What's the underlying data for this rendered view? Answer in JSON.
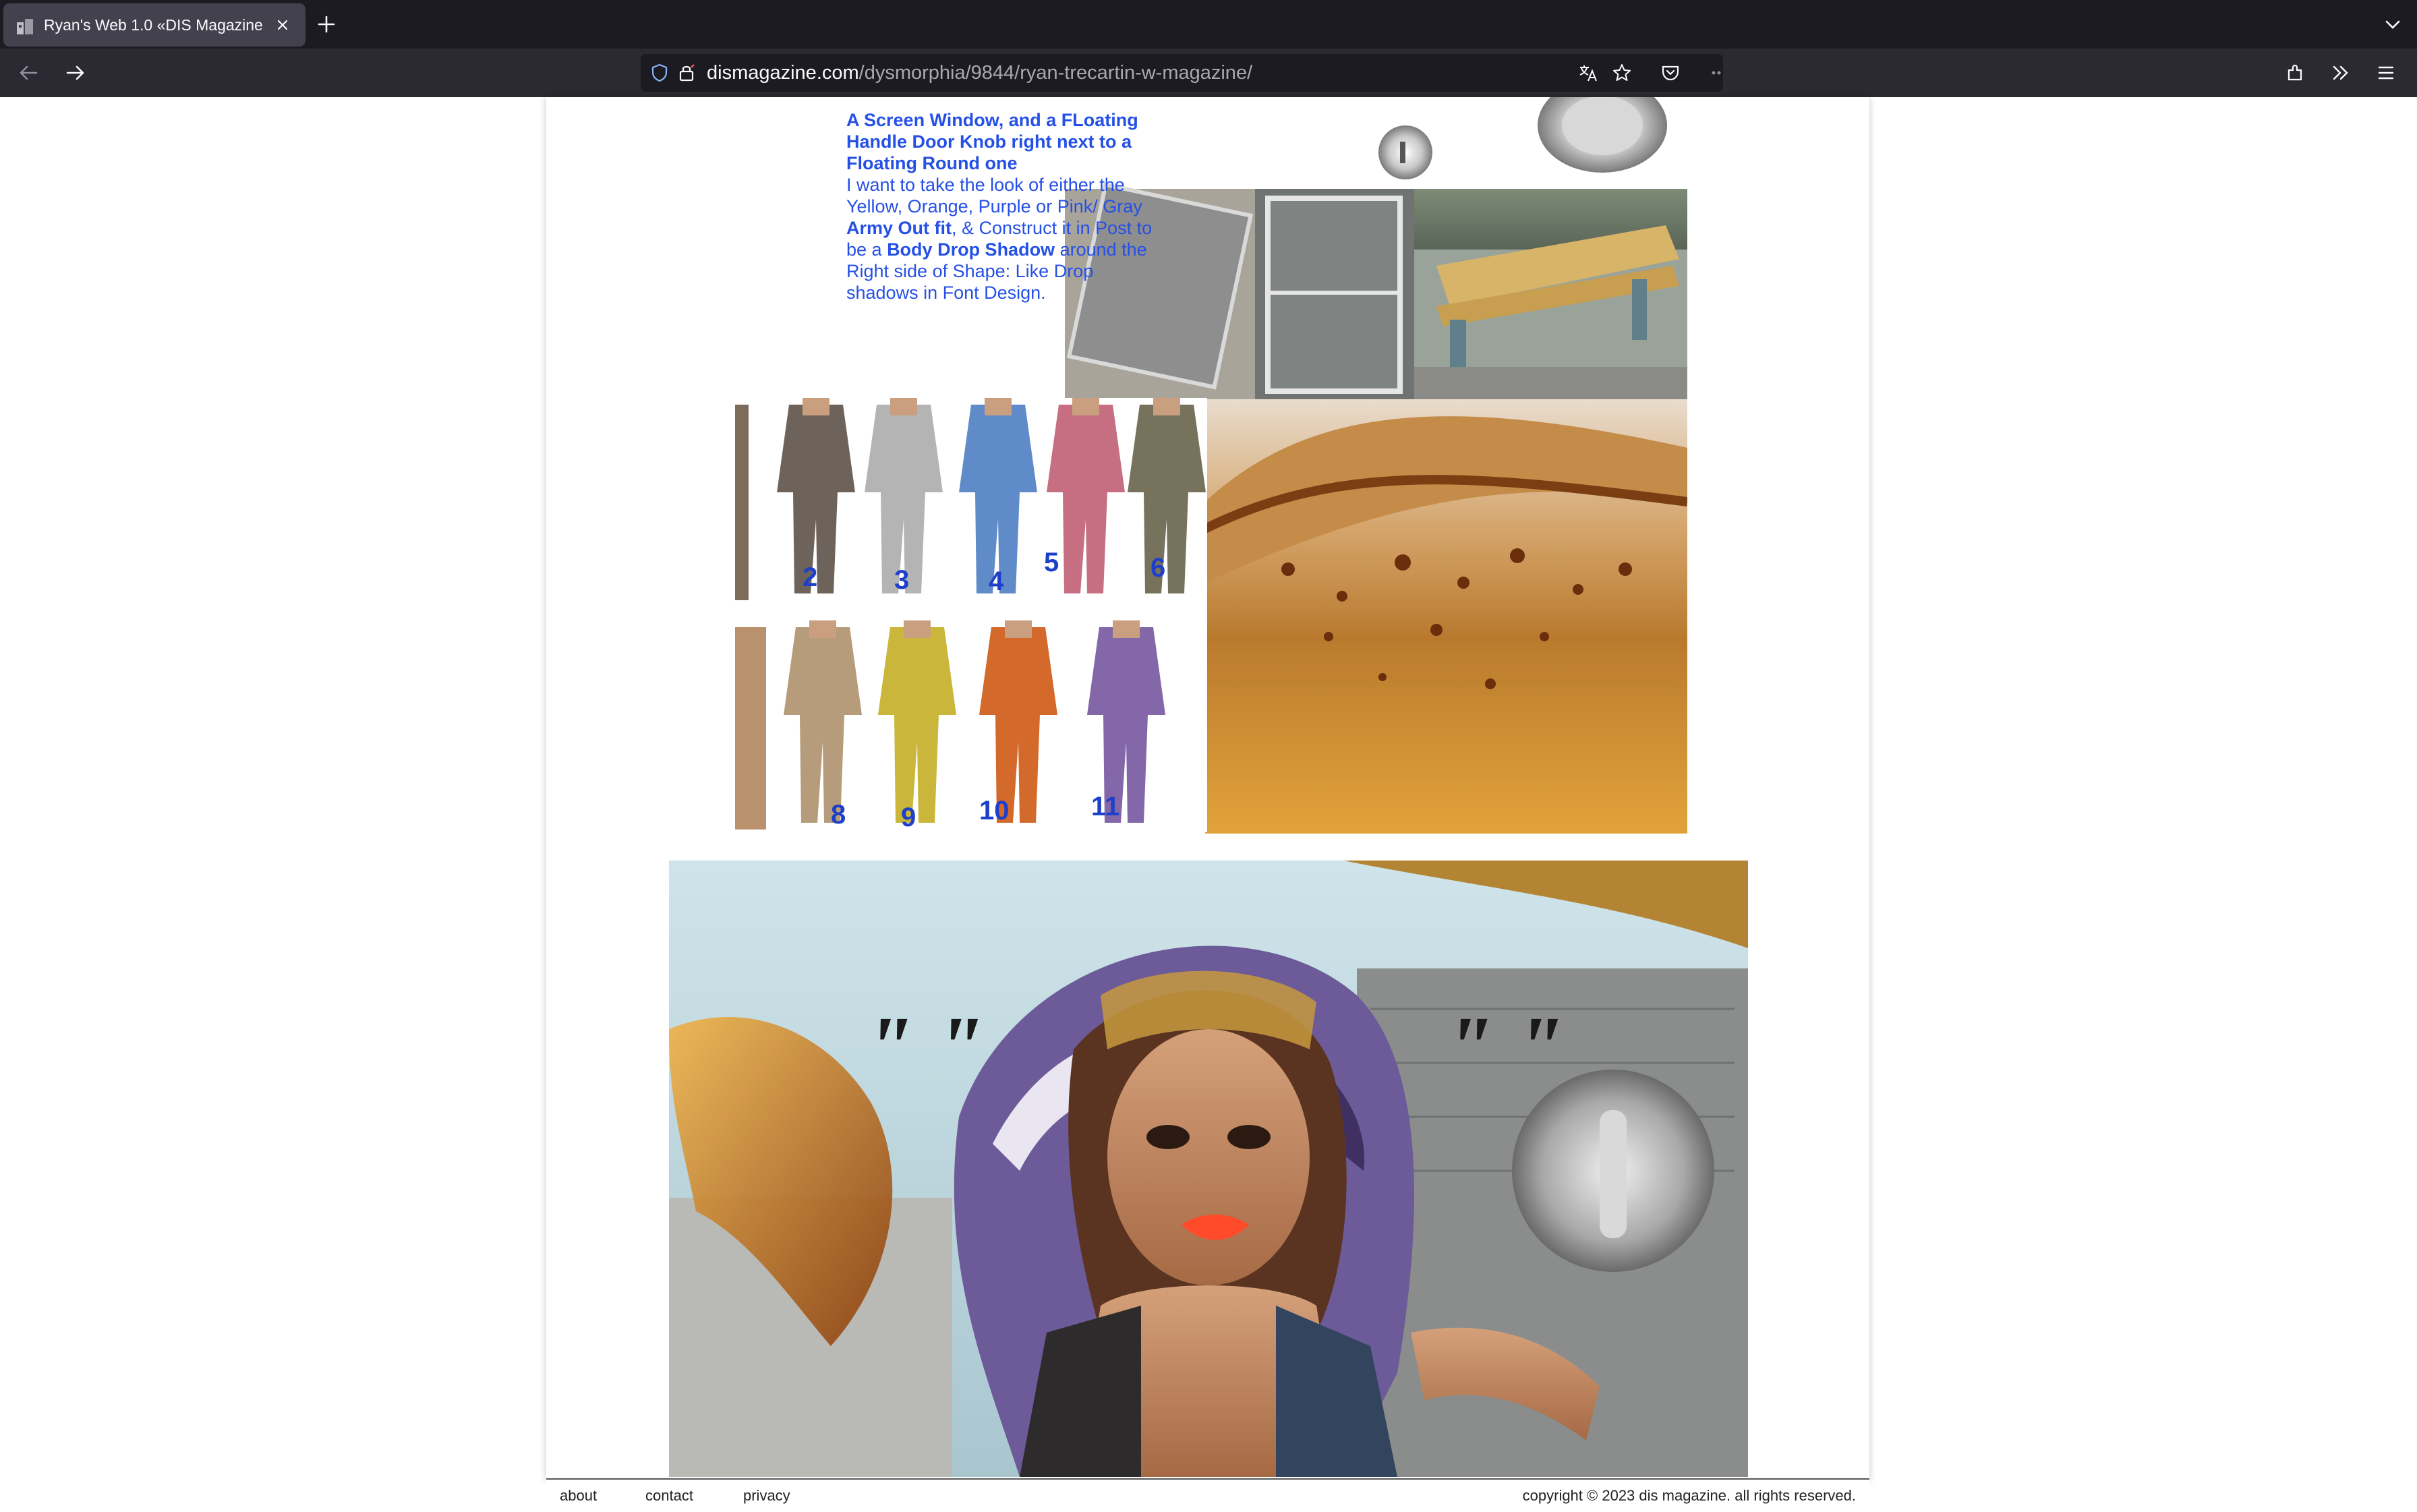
{
  "browser": {
    "tab_title": "Ryan's Web 1.0 «DIS Magazine",
    "url_domain": "dismagazine.com",
    "url_path": "/dysmorphia/9844/ryan-trecartin-w-magazine/",
    "icons": [
      "back-arrow-icon",
      "forward-arrow-icon",
      "shield-icon",
      "lock-icon",
      "translate-icon",
      "star-icon",
      "pocket-icon",
      "extensions-icon",
      "overflow-icon",
      "menu-icon",
      "close-icon",
      "plus-icon",
      "chevron-down-icon"
    ]
  },
  "collage": {
    "caption_heading": "A Screen Window, and a FLoating Handle Door Knob right next to a Floating Round one",
    "caption_body": [
      {
        "text": "I want to take the look of either the Yellow, Orange, Purple or Pink/ Gray ",
        "bold": false
      },
      {
        "text": "Army Out fit",
        "bold": true
      },
      {
        "text": ", & Construct it in Post to be a ",
        "bold": false
      },
      {
        "text": "Body Drop Shadow",
        "bold": true
      },
      {
        "text": " around the Right side of Shape: Like Drop shadows in Font Design.",
        "bold": false
      }
    ],
    "suit_numbers": [
      "2",
      "3",
      "4",
      "5",
      "6",
      "8",
      "9",
      "10",
      "11"
    ]
  },
  "footer": {
    "links": [
      "about",
      "contact",
      "privacy"
    ],
    "copyright": "copyright © 2023 dis magazine. all rights reserved."
  },
  "colors": {
    "caption_blue": "#2550e6",
    "number_blue": "#1d3fc9",
    "chrome_dark": "#1c1b22",
    "chrome_nav": "#2b2a33"
  }
}
